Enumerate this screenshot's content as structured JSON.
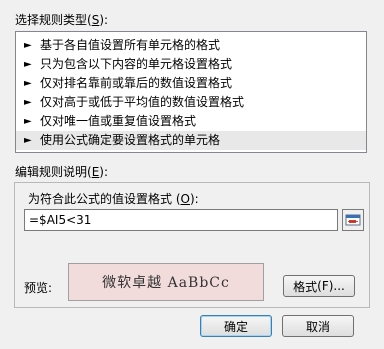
{
  "section_type": {
    "label_prefix": "选择规则类型(",
    "hotkey": "S",
    "label_suffix": "):"
  },
  "rules": [
    "基于各自值设置所有单元格的格式",
    "只为包含以下内容的单元格设置格式",
    "仅对排名靠前或靠后的数值设置格式",
    "仅对高于或低于平均值的数值设置格式",
    "仅对唯一值或重复值设置格式",
    "使用公式确定要设置格式的单元格"
  ],
  "selected_rule_index": 5,
  "section_desc": {
    "label": "编辑规则说明",
    "hotkey": "E",
    "suffix": "):"
  },
  "formula_label": {
    "prefix": "为符合此公式的值设置格式 (",
    "hotkey": "O",
    "suffix": "):"
  },
  "formula_value": "=$AI5<31",
  "preview": {
    "label": "预览:",
    "sample_text": "微软卓越   AaBbCc",
    "background": "#f2dcdb"
  },
  "buttons": {
    "format": {
      "text": "格式",
      "hotkey_part": "(F)...",
      "suffix": ""
    },
    "ok": "确定",
    "cancel": "取消"
  },
  "icons": {
    "rule_arrow": "►"
  }
}
